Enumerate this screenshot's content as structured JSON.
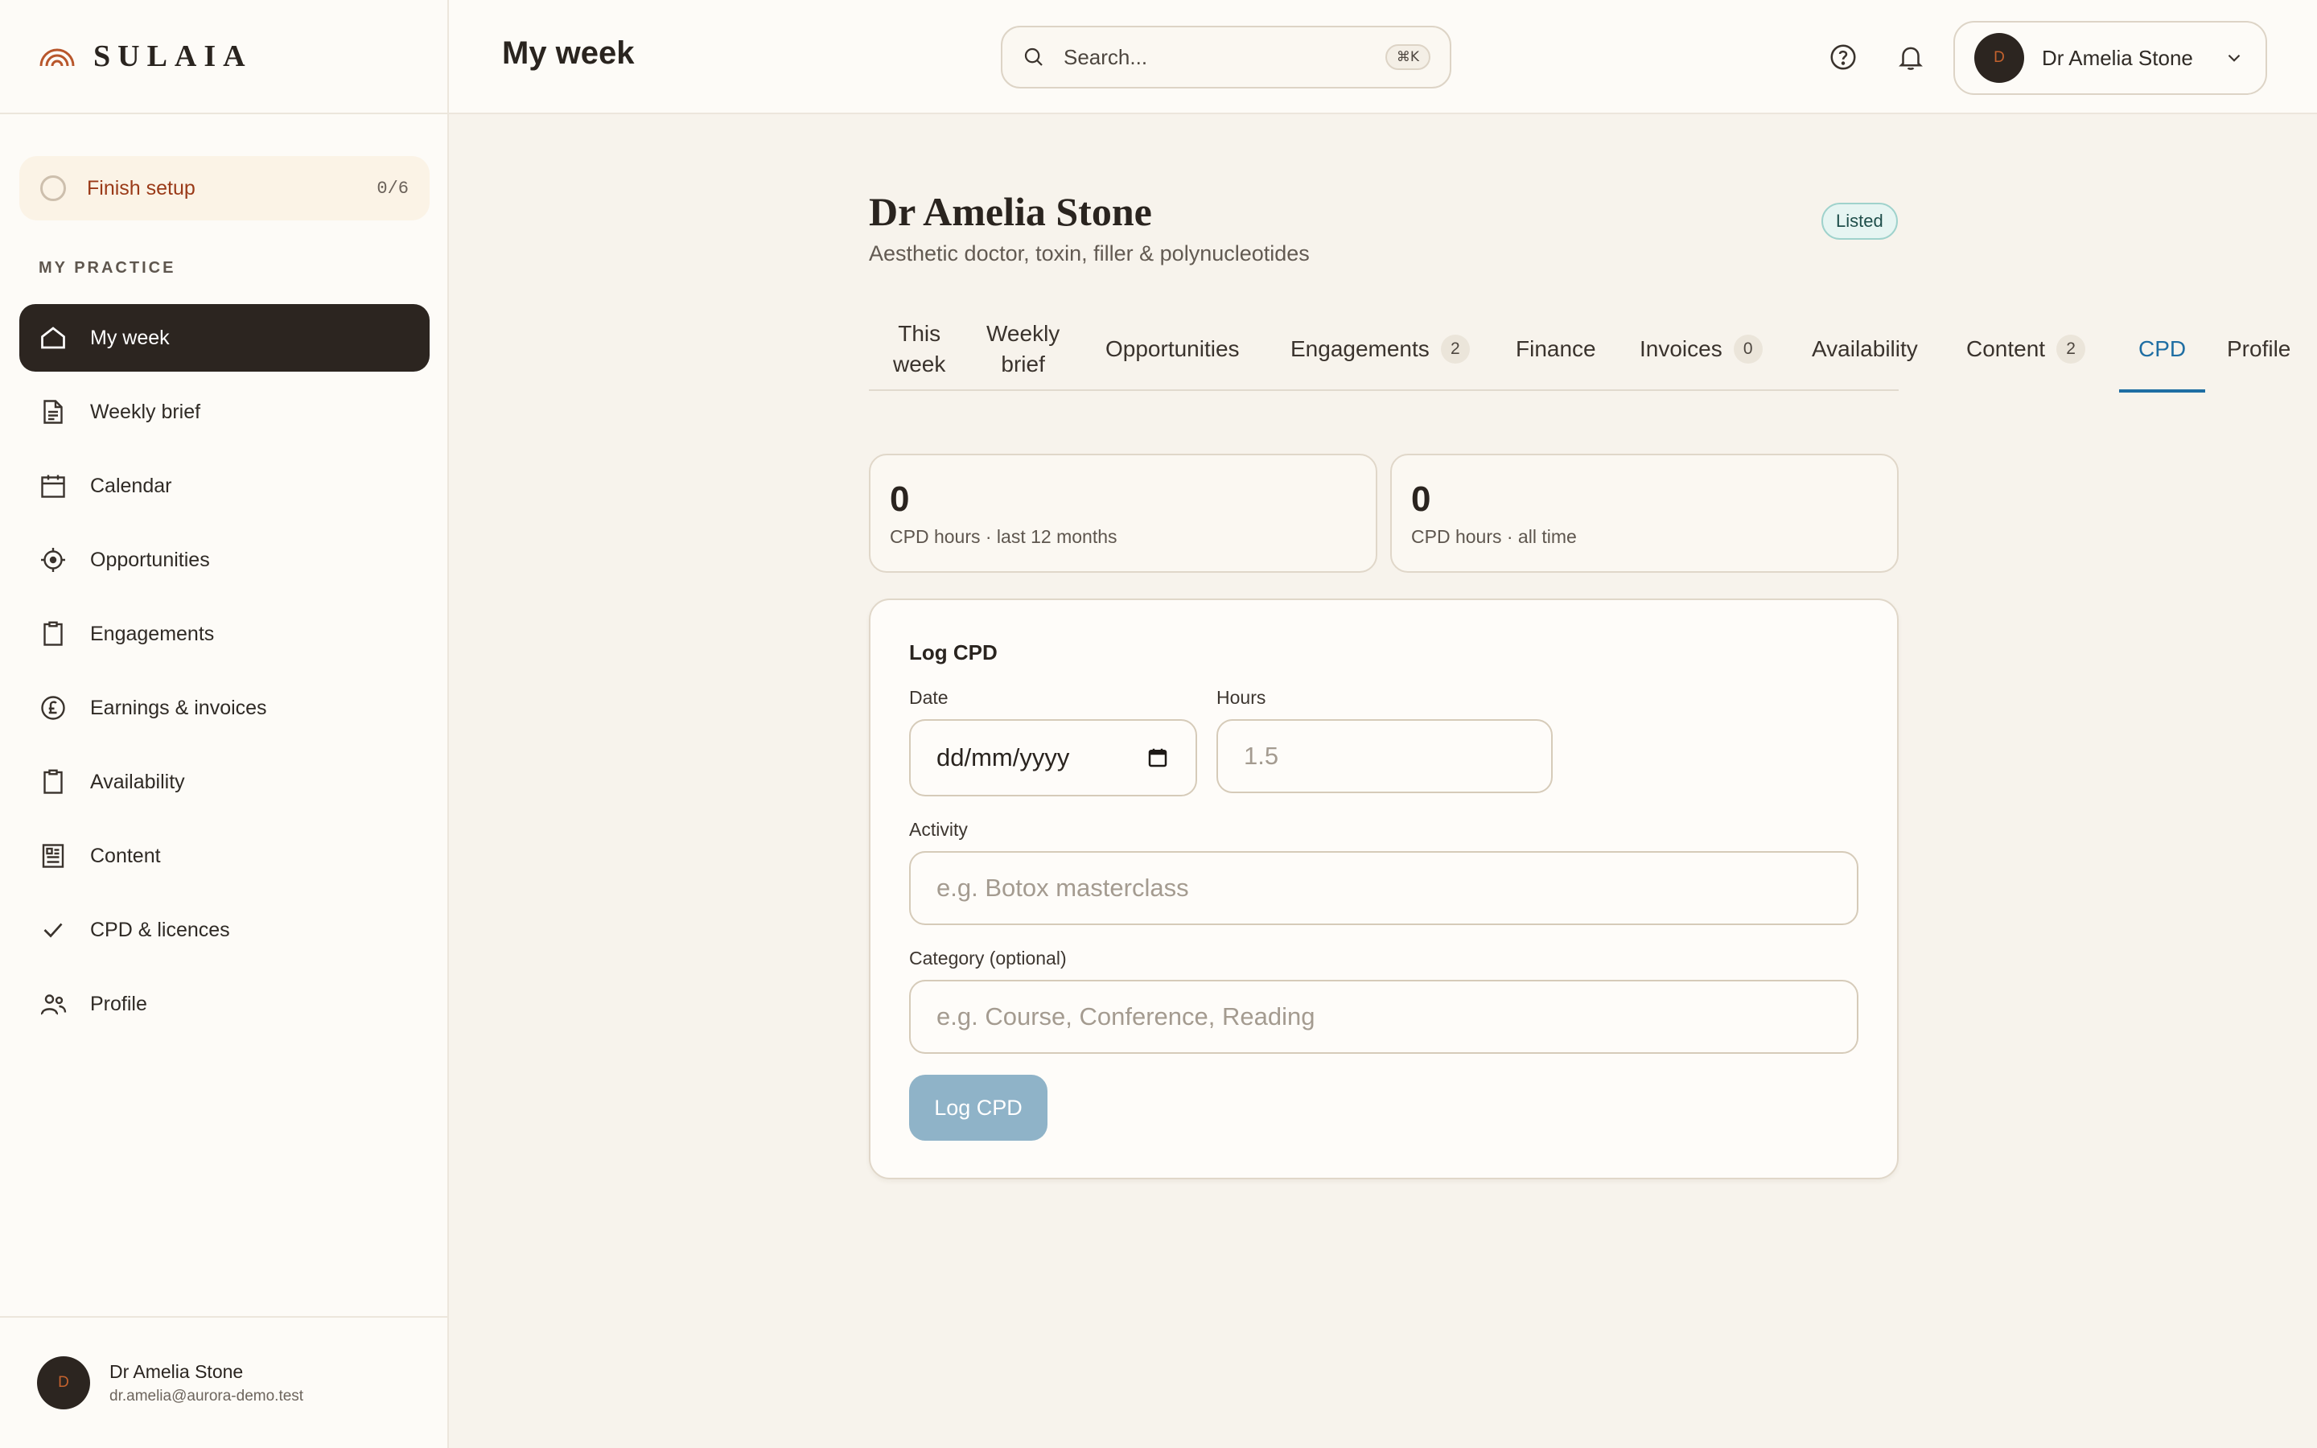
{
  "brand": {
    "name": "SULAIA"
  },
  "sidebar": {
    "setup": {
      "label": "Finish setup",
      "count": "0/6"
    },
    "section_label": "MY PRACTICE",
    "items": [
      {
        "label": "My week",
        "icon": "home-icon",
        "active": true
      },
      {
        "label": "Weekly brief",
        "icon": "document-icon"
      },
      {
        "label": "Calendar",
        "icon": "calendar-icon"
      },
      {
        "label": "Opportunities",
        "icon": "target-icon"
      },
      {
        "label": "Engagements",
        "icon": "clipboard-icon"
      },
      {
        "label": "Earnings & invoices",
        "icon": "pound-icon"
      },
      {
        "label": "Availability",
        "icon": "clipboard-icon"
      },
      {
        "label": "Content",
        "icon": "newspaper-icon"
      },
      {
        "label": "CPD & licences",
        "icon": "check-icon"
      },
      {
        "label": "Profile",
        "icon": "users-icon"
      }
    ],
    "user": {
      "initial": "D",
      "name": "Dr Amelia Stone",
      "email": "dr.amelia@aurora-demo.test"
    }
  },
  "header": {
    "title": "My week",
    "search": {
      "placeholder": "Search...",
      "shortcut": "⌘K"
    },
    "account": {
      "initial": "D",
      "name": "Dr Amelia Stone"
    }
  },
  "profile": {
    "name": "Dr Amelia Stone",
    "subtitle": "Aesthetic doctor, toxin, filler & polynucleotides",
    "status": "Listed"
  },
  "tabs": [
    {
      "label_line1": "This",
      "label_line2": "week"
    },
    {
      "label_line1": "Weekly",
      "label_line2": "brief"
    },
    {
      "label": "Opportunities"
    },
    {
      "label": "Engagements",
      "count": "2"
    },
    {
      "label": "Finance"
    },
    {
      "label": "Invoices",
      "count": "0"
    },
    {
      "label": "Availability"
    },
    {
      "label": "Content",
      "count": "2"
    },
    {
      "label": "CPD",
      "active": true
    },
    {
      "label": "Profile"
    }
  ],
  "stats": [
    {
      "value": "0",
      "label": "CPD hours · last 12 months"
    },
    {
      "value": "0",
      "label": "CPD hours · all time"
    }
  ],
  "form": {
    "title": "Log CPD",
    "date": {
      "label": "Date",
      "value": "dd/mm/yyyy"
    },
    "hours": {
      "label": "Hours",
      "placeholder": "1.5"
    },
    "activity": {
      "label": "Activity",
      "placeholder": "e.g. Botox masterclass"
    },
    "category": {
      "label": "Category (optional)",
      "placeholder": "e.g. Course, Conference, Reading"
    },
    "submit_label": "Log CPD"
  },
  "colors": {
    "accent": "#1f6ea3",
    "brand_orange": "#b8562b",
    "active_nav": "#2c2520",
    "button_disabled": "#8fb3c8",
    "badge_bg": "#e6f5f2"
  }
}
